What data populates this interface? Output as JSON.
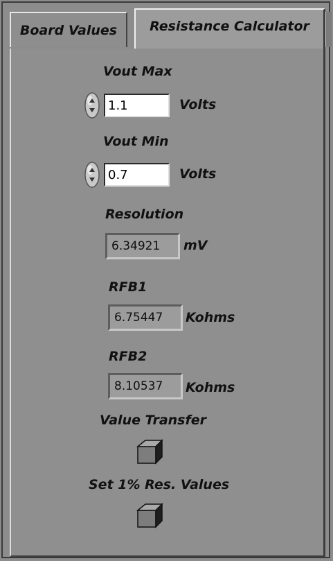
{
  "tabs": [
    {
      "label": "Board Values"
    },
    {
      "label": "Resistance Calculator"
    }
  ],
  "vout_max": {
    "label": "Vout Max",
    "value": "1.1",
    "unit": "Volts"
  },
  "vout_min": {
    "label": "Vout Min",
    "value": "0.7",
    "unit": "Volts"
  },
  "resolution": {
    "label": "Resolution",
    "value": "6.34921",
    "unit": "mV"
  },
  "rfb1": {
    "label": "RFB1",
    "value": "6.75447",
    "unit": "Kohms"
  },
  "rfb2": {
    "label": "RFB2",
    "value": "8.10537",
    "unit": "Kohms"
  },
  "value_transfer": {
    "label": "Value Transfer"
  },
  "set_res_values": {
    "label": "Set 1% Res. Values"
  }
}
